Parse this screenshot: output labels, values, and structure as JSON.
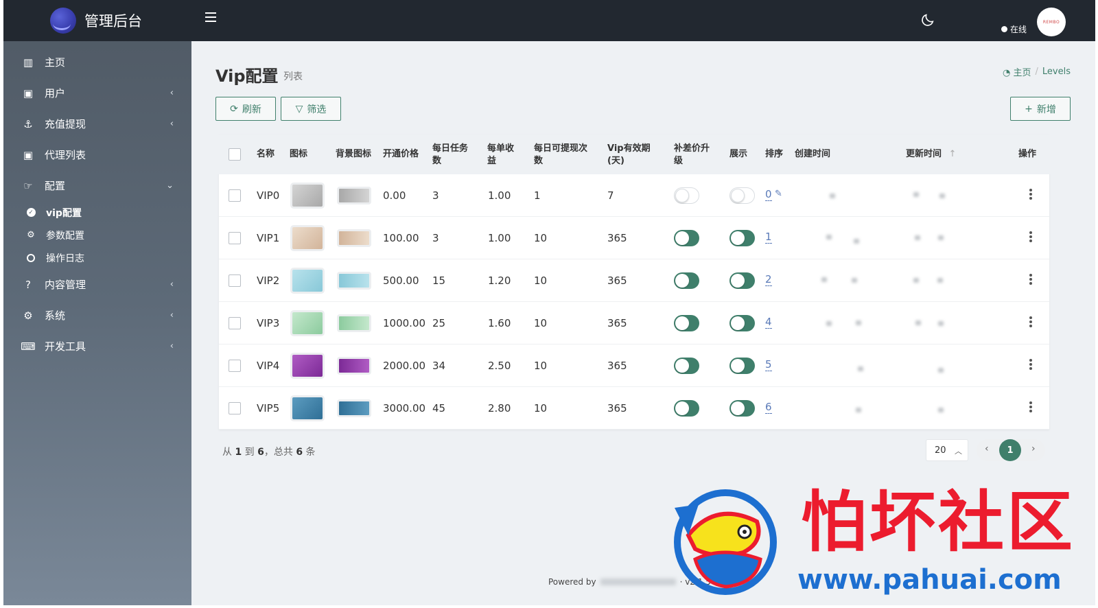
{
  "brand": {
    "title": "管理后台"
  },
  "sidebar": {
    "items": [
      {
        "label": "主页",
        "icon": "bar-chart-icon",
        "glyph": "▥"
      },
      {
        "label": "用户",
        "icon": "user-icon",
        "glyph": "▣",
        "arrow": "‹"
      },
      {
        "label": "充值提现",
        "icon": "anchor-icon",
        "glyph": "⚓",
        "arrow": "‹"
      },
      {
        "label": "代理列表",
        "icon": "user-card-icon",
        "glyph": "▣"
      },
      {
        "label": "配置",
        "icon": "hand-icon",
        "glyph": "☞",
        "arrow": "⌄"
      }
    ],
    "sub_items": [
      {
        "label": "vip配置",
        "icon": "check-circle-icon"
      },
      {
        "label": "参数配置",
        "icon": "cogs-icon"
      },
      {
        "label": "操作日志",
        "icon": "circle-icon"
      }
    ],
    "items_after": [
      {
        "label": "内容管理",
        "icon": "question-circle-icon",
        "glyph": "?",
        "arrow": "‹"
      },
      {
        "label": "系统",
        "icon": "gear-icon",
        "glyph": "⚙",
        "arrow": "‹"
      },
      {
        "label": "开发工具",
        "icon": "keyboard-icon",
        "glyph": "⌨",
        "arrow": "‹"
      }
    ]
  },
  "topbar": {
    "status": "在线",
    "avatar_text": "REMBO"
  },
  "page": {
    "title": "Vip配置",
    "subtitle": "列表"
  },
  "breadcrumb": {
    "home": "主页",
    "current": "Levels",
    "separator": "/"
  },
  "toolbar": {
    "refresh": "刷新",
    "filter": "筛选",
    "add": "新增"
  },
  "table": {
    "headers": {
      "name": "名称",
      "icon": "图标",
      "bg_icon": "背景图标",
      "price": "开通价格",
      "tasks": "每日任务数",
      "income": "每单收益",
      "withdraw": "每日可提现次数",
      "validity": "Vip有效期(天)",
      "upgrade": "补差价升级",
      "show": "展示",
      "sort": "排序",
      "created": "创建时间",
      "updated": "更新时间",
      "ops": "操作"
    },
    "rows": [
      {
        "name": "VIP0",
        "price": "0.00",
        "tasks": "3",
        "income": "1.00",
        "withdraw": "1",
        "validity": "7",
        "upgrade": false,
        "show": false,
        "sort": "0",
        "color_a": "#d4d4d4",
        "color_b": "#a8a8a8"
      },
      {
        "name": "VIP1",
        "price": "100.00",
        "tasks": "3",
        "income": "1.00",
        "withdraw": "10",
        "validity": "365",
        "upgrade": true,
        "show": true,
        "sort": "1",
        "color_a": "#ecdccb",
        "color_b": "#d2b49a"
      },
      {
        "name": "VIP2",
        "price": "500.00",
        "tasks": "15",
        "income": "1.20",
        "withdraw": "10",
        "validity": "365",
        "upgrade": true,
        "show": true,
        "sort": "2",
        "color_a": "#b8e2ec",
        "color_b": "#88c8d8"
      },
      {
        "name": "VIP3",
        "price": "1000.00",
        "tasks": "25",
        "income": "1.60",
        "withdraw": "10",
        "validity": "365",
        "upgrade": true,
        "show": true,
        "sort": "4",
        "color_a": "#c4e8cc",
        "color_b": "#8ccb9e"
      },
      {
        "name": "VIP4",
        "price": "2000.00",
        "tasks": "34",
        "income": "2.50",
        "withdraw": "10",
        "validity": "365",
        "upgrade": true,
        "show": true,
        "sort": "5",
        "color_a": "#b05cc4",
        "color_b": "#7c2a96"
      },
      {
        "name": "VIP5",
        "price": "3000.00",
        "tasks": "45",
        "income": "2.80",
        "withdraw": "10",
        "validity": "365",
        "upgrade": true,
        "show": true,
        "sort": "6",
        "color_a": "#5c9cc0",
        "color_b": "#2f6f96"
      }
    ]
  },
  "summary": {
    "prefix": "从",
    "from": "1",
    "to_word": "到",
    "to": "6",
    "total_word": "，总共",
    "total": "6",
    "unit": "条"
  },
  "pagination": {
    "page_size": "20",
    "current": "1",
    "prev": "‹",
    "next": "›"
  },
  "footer": {
    "powered": "Powered by",
    "version": "· v2.1.5-beta"
  },
  "watermark": {
    "text": "怕坏社区",
    "url": "www.pahuai.com"
  },
  "colors": {
    "accent": "#3f7f6b",
    "topbar": "#222830",
    "watermark_red": "#ec1c2e",
    "watermark_blue": "#1d6fd0"
  }
}
